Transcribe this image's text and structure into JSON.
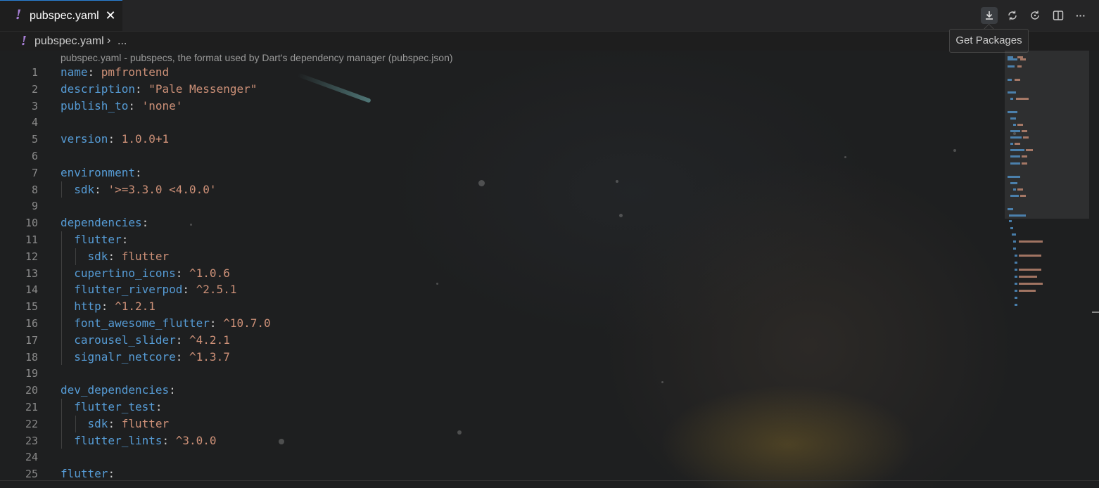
{
  "tab": {
    "icon": "!",
    "label": "pubspec.yaml",
    "close": "✕"
  },
  "toolbar": {
    "get_packages_icon": "download-icon",
    "refresh_icon": "sync-icon",
    "restart_icon": "refresh-icon",
    "split_icon": "split-editor-icon",
    "more_icon": "more-icon",
    "more_glyph": "···"
  },
  "tooltip": {
    "text": "Get Packages"
  },
  "breadcrumb": {
    "icon": "!",
    "file": "pubspec.yaml",
    "separator": "›",
    "more": "..."
  },
  "editor": {
    "codelens": "pubspec.yaml - pubspecs, the format used by Dart's dependency manager (pubspec.json)",
    "line_numbers": [
      "1",
      "2",
      "3",
      "4",
      "5",
      "6",
      "7",
      "8",
      "9",
      "10",
      "11",
      "12",
      "13",
      "14",
      "15",
      "16",
      "17",
      "18",
      "19",
      "20",
      "21",
      "22",
      "23",
      "24",
      "25"
    ],
    "lines": [
      {
        "indent": "",
        "key": "name",
        "sep": ": ",
        "value": "pmfrontend"
      },
      {
        "indent": "",
        "key": "description",
        "sep": ": ",
        "value": "\"Pale Messenger\""
      },
      {
        "indent": "",
        "key": "publish_to",
        "sep": ": ",
        "value": "'none'"
      },
      {
        "indent": "",
        "key": "",
        "sep": "",
        "value": ""
      },
      {
        "indent": "",
        "key": "version",
        "sep": ": ",
        "value": "1.0.0+1"
      },
      {
        "indent": "",
        "key": "",
        "sep": "",
        "value": ""
      },
      {
        "indent": "",
        "key": "environment",
        "sep": ":",
        "value": ""
      },
      {
        "indent": "  ",
        "key": "sdk",
        "sep": ": ",
        "value": "'>=3.3.0 <4.0.0'"
      },
      {
        "indent": "",
        "key": "",
        "sep": "",
        "value": ""
      },
      {
        "indent": "",
        "key": "dependencies",
        "sep": ":",
        "value": ""
      },
      {
        "indent": "  ",
        "key": "flutter",
        "sep": ":",
        "value": ""
      },
      {
        "indent": "    ",
        "key": "sdk",
        "sep": ": ",
        "value": "flutter"
      },
      {
        "indent": "  ",
        "key": "cupertino_icons",
        "sep": ": ",
        "value": "^1.0.6"
      },
      {
        "indent": "  ",
        "key": "flutter_riverpod",
        "sep": ": ",
        "value": "^2.5.1"
      },
      {
        "indent": "  ",
        "key": "http",
        "sep": ": ",
        "value": "^1.2.1"
      },
      {
        "indent": "  ",
        "key": "font_awesome_flutter",
        "sep": ": ",
        "value": "^10.7.0"
      },
      {
        "indent": "  ",
        "key": "carousel_slider",
        "sep": ": ",
        "value": "^4.2.1"
      },
      {
        "indent": "  ",
        "key": "signalr_netcore",
        "sep": ": ",
        "value": "^1.3.7"
      },
      {
        "indent": "",
        "key": "",
        "sep": "",
        "value": ""
      },
      {
        "indent": "",
        "key": "dev_dependencies",
        "sep": ":",
        "value": ""
      },
      {
        "indent": "  ",
        "key": "flutter_test",
        "sep": ":",
        "value": ""
      },
      {
        "indent": "    ",
        "key": "sdk",
        "sep": ": ",
        "value": "flutter"
      },
      {
        "indent": "  ",
        "key": "flutter_lints",
        "sep": ": ",
        "value": "^3.0.0"
      },
      {
        "indent": "",
        "key": "",
        "sep": "",
        "value": ""
      },
      {
        "indent": "",
        "key": "flutter",
        "sep": ":",
        "value": ""
      }
    ]
  },
  "colors": {
    "key": "#569cd6",
    "value": "#ce9178",
    "punctuation": "#cccccc",
    "yaml_icon": "#a77fd6",
    "tab_accent": "#2a7fd4"
  }
}
